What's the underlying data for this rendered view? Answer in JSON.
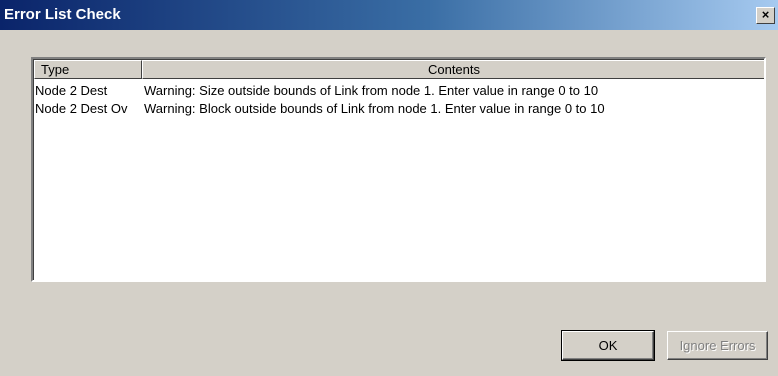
{
  "window": {
    "title": "Error List Check",
    "close_symbol": "×"
  },
  "list": {
    "columns": [
      "Type",
      "Contents"
    ],
    "rows": [
      {
        "type": "Node 2 Dest",
        "contents": "Warning: Size outside bounds of Link from node 1. Enter value in  range 0 to 10"
      },
      {
        "type": "Node 2 Dest Ov",
        "contents": "Warning: Block outside bounds of Link from node 1. Enter value in  range 0 to 10"
      }
    ]
  },
  "buttons": {
    "ok_label": "OK",
    "ignore_label": "Ignore Errors"
  }
}
